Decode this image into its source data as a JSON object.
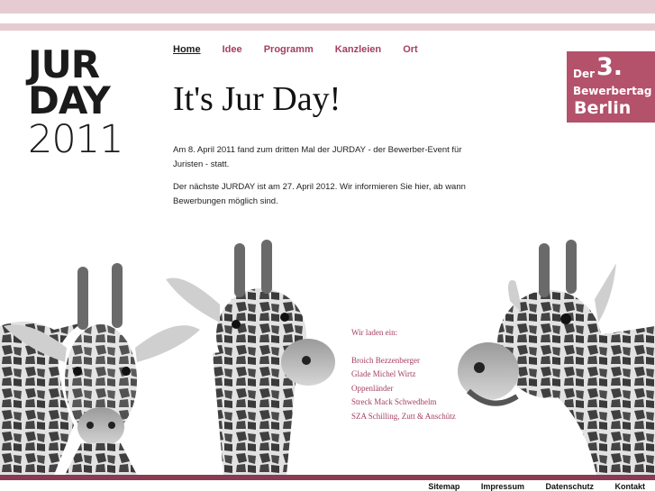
{
  "logo": {
    "line1": "JUR",
    "line2": "DAY",
    "line3": "2011"
  },
  "nav": [
    {
      "label": "Home",
      "active": true
    },
    {
      "label": "Idee"
    },
    {
      "label": "Programm"
    },
    {
      "label": "Kanzleien"
    },
    {
      "label": "Ort"
    }
  ],
  "page_title": "It's Jur Day!",
  "intro": {
    "p1": "Am 8. April 2011 fand zum dritten Mal der JURDAY - der Bewerber-Event für Juristen - statt.",
    "p2": "Der nächste JURDAY ist am 27. April 2012. Wir informieren Sie hier, ab wann Bewerbungen möglich sind."
  },
  "badge": {
    "der": "Der",
    "number": "3.",
    "line2": "Bewerbertag",
    "city": "Berlin"
  },
  "invite": {
    "heading": "Wir laden ein:",
    "firms": [
      "Broich Bezzenberger",
      "Glade Michel Wirtz",
      "Oppenländer",
      "Streck Mack Schwedhelm",
      "SZA Schilling, Zutt & Anschütz"
    ]
  },
  "footer": [
    "Sitemap",
    "Impressum",
    "Datenschutz",
    "Kontakt"
  ],
  "colors": {
    "accent": "#a43f60",
    "stripe": "#e6cbd3",
    "badge": "#b4516b",
    "footbar": "#8b3a53"
  }
}
